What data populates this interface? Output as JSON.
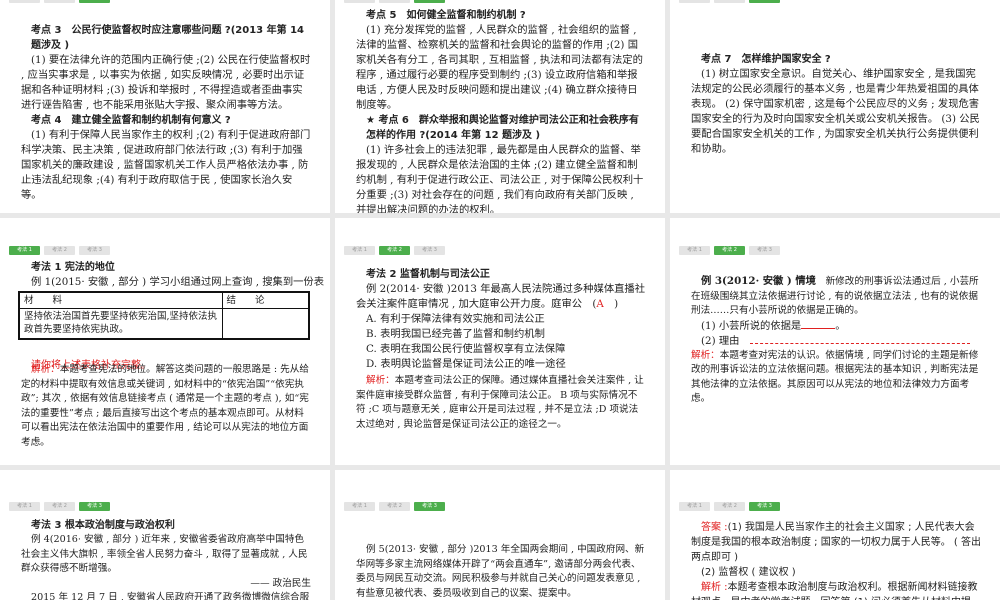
{
  "tabs": [
    "考法 1",
    "考法 2",
    "考法 3"
  ],
  "p1": {
    "h1": "考点 3　公民行使监督权时应注意哪些问题 ?(2013 年第 14 题涉及 )",
    "t1": "(1) 要在法律允许的范围内正确行使 ;(2) 公民在行使监督权时 , 应当实事求是 , 以事实为依据 , 如实反映情况 , 必要时出示证据和各种证明材料 ;(3) 投诉和举报时 , 不得捏造或者歪曲事实进行诬告陷害 , 也不能采用张贴大字报、聚众闹事等方法。",
    "h2": "考点 4　建立健全监督和制约机制有何意义 ?",
    "t2": "(1) 有利于保障人民当家作主的权利 ;(2) 有利于促进政府部门科学决策、民主决策 , 促进政府部门依法行政 ;(3) 有利于加强国家机关的廉政建设 , 监督国家机关工作人员严格依法办事 , 防止违法乱纪现象 ;(4) 有利于政府取信于民 , 使国家长治久安等。"
  },
  "p2": {
    "h1": "考点 5　如何健全监督和制约机制 ?",
    "t1": "(1) 充分发挥党的监督 , 人民群众的监督 , 社会组织的监督 , 法律的监督、检察机关的监督和社会舆论的监督的作用 ;(2) 国家机关各有分工 , 各司其职 , 互相监督 , 执法和司法都有法定的程序 , 通过履行必要的程序受到制约 ;(3) 设立政府信箱和举报电话 , 方便人民及时反映问题和提出建议 ;(4) 确立群众接待日制度等。",
    "h2": "★ 考点 6　群众举报和舆论监督对维护司法公正和社会秩序有怎样的作用 ?(2014 年第 12 题涉及 )",
    "t2": "(1) 许多社会上的违法犯罪 , 最先都是由人民群众的监督、举报发现的 , 人民群众是依法治国的主体 ;(2) 建立健全监督和制约机制 , 有利于促进行政公正、司法公正 , 对于保障公民权利十分重要 ;(3) 对社会存在的问题 , 我们有向政府有关部门反映 , 并提出解决问题的办法的权利。"
  },
  "p3": {
    "h1": "考点 7　怎样维护国家安全 ?",
    "t1": "(1) 树立国家安全意识。自觉关心、维护国家安全 , 是我国宪法规定的公民必须履行的基本义务 , 也是青少年热爱祖国的具体表现。 (2) 保守国家机密 , 这是每个公民应尽的义务 ; 发现危害国家安全的行为及时向国家安全机关或公安机关报告。 (3) 公民要配合国家安全机关的工作 , 为国家安全机关执行公务提供便利和协助。"
  },
  "p4": {
    "h": "考法 1 宪法的地位",
    "ex": "例 1(2015· 安徽 , 部分 ) 学习小组通过网上查询 , 搜集到一份表",
    "col1": "材　　料",
    "col2": "结　　论",
    "cell": "坚持依法治国首先要坚持依宪治国,坚持依法执政首先要坚持依宪执政。",
    "prompt": "请你将上述表格补充完整。",
    "label": "解析：",
    "analysis": "本题考查宪法的地位。解答这类问题的一般思路是 : 先从给定的材料中提取有效信息或关键词 , 如材料中的“依宪治国”“依宪执政”; 其次 , 依据有效信息链接考点 ( 通常是一个主题的考点 ), 如“宪法的重要性”考点 ; 最后直接写出这个考点的基本观点即可。从材料可以看出宪法在依法治国中的重要作用 , 结论可以从宪法的地位方面考虑。"
  },
  "p5": {
    "h": "考法 2 监督机制与司法公正",
    "ex": "例 2(2014· 安徽 )2013 年最高人民法院通过多种媒体直播社会关注案件庭审情况 , 加大庭审公开力度。庭审公",
    "answer": "A",
    "options": [
      "A. 有利于保障法律有效实施和司法公正",
      "B. 表明我国已经完善了监督和制约机制",
      "C. 表明在我国公民行使监督权享有立法保障",
      "D. 表明舆论监督是保证司法公正的唯一途径"
    ],
    "label": "解析：",
    "analysis": "本题考查司法公正的保障。通过媒体直播社会关注案件 , 让案件庭审接受群众监督 , 有利于保障司法公正。 B 项与实际情况不符 ;C 项与题意无关 , 庭审公开是司法过程 , 并不是立法 ;D 项说法太过绝对 , 舆论监督是保证司法公正的途径之一。"
  },
  "p6": {
    "ex_label": "例 3(2012· 安徽 ) 情境",
    "ex": "新修改的刑事诉讼法通过后 , 小芸所在班级围绕其立法依据进行讨论 , 有的说依据立法法 , 也有的说依据刑法……只有小芸所说的依据是正确的。",
    "q1": "(1) 小芸所说的依据是",
    "q2": "(2) 理由",
    "label": "解析：",
    "analysis": "本题考查对宪法的认识。依据情境 , 同学们讨论的主题是新修改的刑事诉讼法的立法依据问题。根据宪法的基本知识 , 判断宪法是其他法律的立法依据。其原因可以从宪法的地位和法律效力方面考虑。"
  },
  "p7": {
    "h": "考法 3 根本政治制度与政治权利",
    "ex": "例 4(2016· 安徽 , 部分 ) 近年来 , 安徽省委省政府高举中国特色社会主义伟大旗帜 , 率领全省人民努力奋斗 , 取得了显著成就 , 人民群众获得感不断增强。",
    "source": "—— 政治民生",
    "t": "2015 年 12 月 7 日 , 安徽省人民政府开通了政务微博微信综合服"
  },
  "p8": {
    "ex": "例 5(2013· 安徽 , 部分 )2013 年全国两会期间 , 中国政府网、新华网等多家主流网络媒体开辟了“两会直通车”, 邀请部分两会代表、委员与网民互动交流。网民积极参与并就自己关心的问题发表意见 , 有些意见被代表、委员吸收到自己的议案、提案中。"
  },
  "p9": {
    "ans_label": "答案 :",
    "ans1": "(1) 我国是人民当家作主的社会主义国家 ; 人民代表大会制度是我国的根本政治制度 ; 国家的一切权力属于人民等。 ( 答出两点即可 )",
    "ans2": "(2) 监督权 ( 建议权 )",
    "label": "解析 :",
    "analysis": "本题考查根本政治制度与政治权利。根据新闻材料链接教材观点 , 是中考的常考试题。回答第 (1) 问必须首先从材料中提"
  }
}
